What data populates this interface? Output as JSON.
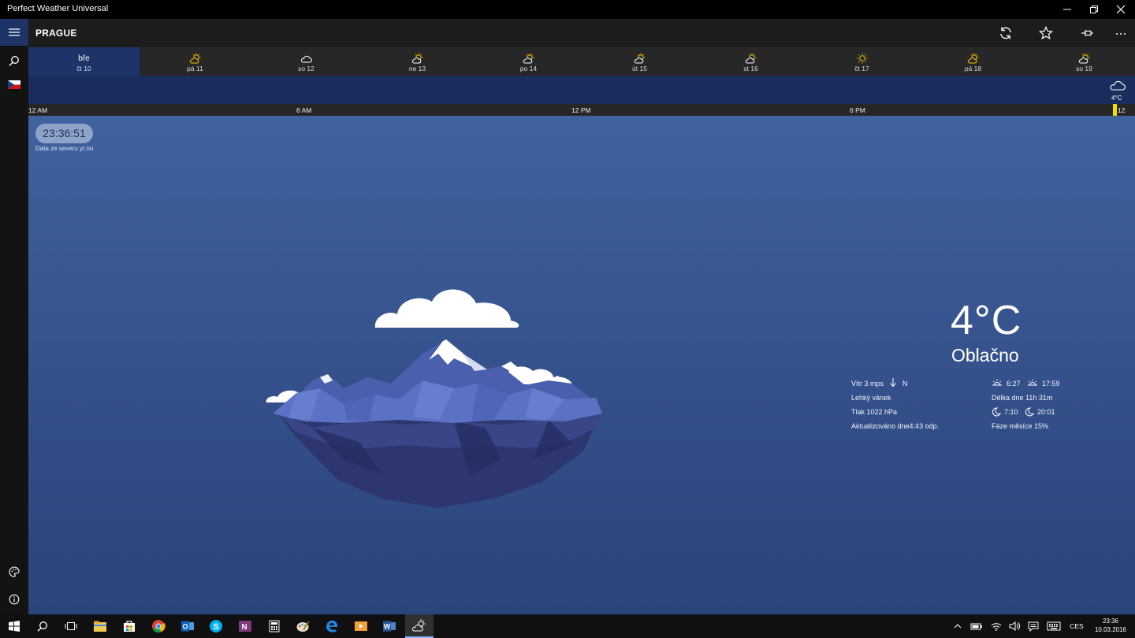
{
  "window": {
    "title": "Perfect Weather Universal"
  },
  "header": {
    "city": "PRAGUE"
  },
  "days": [
    {
      "top": "bře",
      "label": "čt 10",
      "icon": "none",
      "active": true
    },
    {
      "label": "pá 11",
      "icon": "partly-sunny-icon"
    },
    {
      "label": "so 12",
      "icon": "cloud-icon"
    },
    {
      "label": "ne 13",
      "icon": "partly-sunny-icon"
    },
    {
      "label": "po 14",
      "icon": "partly-sunny-icon"
    },
    {
      "label": "út 15",
      "icon": "partly-sunny-icon"
    },
    {
      "label": "st 16",
      "icon": "partly-sunny-icon"
    },
    {
      "label": "čt 17",
      "icon": "sun-icon"
    },
    {
      "label": "pá 18",
      "icon": "partly-sunny-icon"
    },
    {
      "label": "so 19",
      "icon": "partly-sunny-icon"
    }
  ],
  "hourly": {
    "now_temp": "4°C",
    "now_icon": "cloud-icon"
  },
  "axis": {
    "ticks": [
      "12 AM",
      "6 AM",
      "12 PM",
      "6 PM",
      "12 AM"
    ]
  },
  "main": {
    "clock": "23:36:51",
    "source": "Data ze severu yr.no",
    "temperature": "4°C",
    "condition": "Oblačno",
    "wind": "Vítr 3 mps",
    "wind_dir": "N",
    "wind_desc": "Lehký vánek",
    "pressure": "Tlak 1022 hPa",
    "updated": "Aktualizováno dne4:43 odp.",
    "sunrise": "6:27",
    "sunset": "17:59",
    "day_length": "Délka dne 11h 31m",
    "moonrise": "7:10",
    "moonset": "20:01",
    "moon_phase": "Fáze měsíce 15%"
  },
  "taskbar": {
    "lang": "CES",
    "time": "23:36",
    "date": "10.03.2016",
    "apps": [
      "file-explorer-icon",
      "store-icon",
      "chrome-icon",
      "outlook-icon",
      "skype-icon",
      "onenote-icon",
      "calculator-icon",
      "paint-icon",
      "edge-icon",
      "media-player-icon",
      "word-icon",
      "weather-app-icon"
    ]
  },
  "colors": {
    "accent_day": "#1e3468",
    "hourly_band": "#1b2d5c",
    "now_marker": "#f0e000",
    "sun_icon": "#f4c300"
  }
}
